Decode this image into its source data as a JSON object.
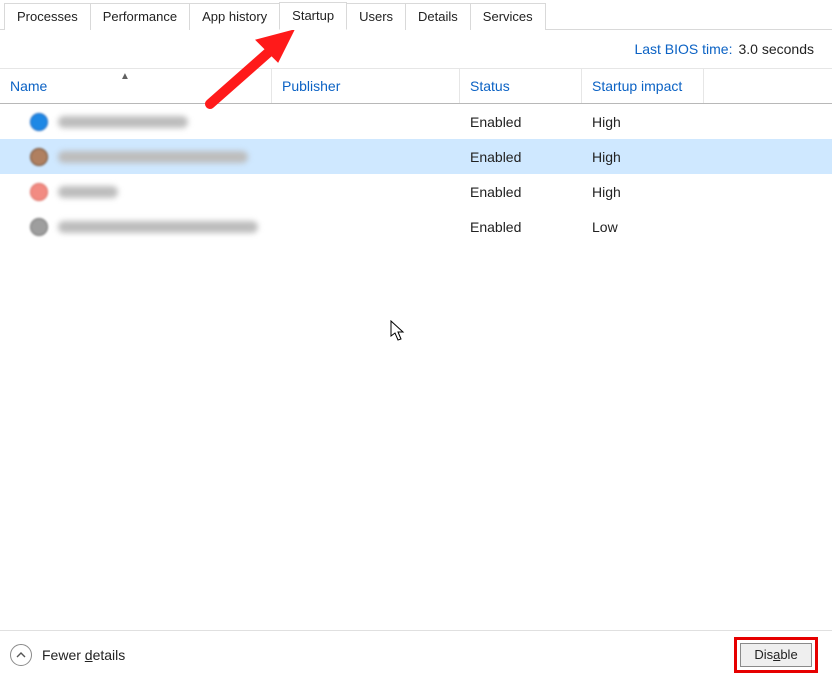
{
  "tabs": {
    "items": [
      {
        "label": "Processes",
        "active": false
      },
      {
        "label": "Performance",
        "active": false
      },
      {
        "label": "App history",
        "active": false
      },
      {
        "label": "Startup",
        "active": true
      },
      {
        "label": "Users",
        "active": false
      },
      {
        "label": "Details",
        "active": false
      },
      {
        "label": "Services",
        "active": false
      }
    ]
  },
  "info": {
    "label": "Last BIOS time:",
    "value": "3.0 seconds"
  },
  "columns": {
    "name": "Name",
    "publisher": "Publisher",
    "status": "Status",
    "impact": "Startup impact"
  },
  "rows": [
    {
      "icon_color": "#1e88e5",
      "name_blur_w": 130,
      "pub_blur_w": 150,
      "status": "Enabled",
      "impact": "High",
      "selected": false,
      "icon_border": "#1565c0"
    },
    {
      "icon_color": "#b08060",
      "name_blur_w": 190,
      "pub_blur_w": 150,
      "status": "Enabled",
      "impact": "High",
      "selected": true,
      "icon_border": "#6e4a30"
    },
    {
      "icon_color": "#f28b82",
      "name_blur_w": 60,
      "pub_blur_w": 150,
      "status": "Enabled",
      "impact": "High",
      "selected": false,
      "icon_border": "#d96a60"
    },
    {
      "icon_color": "#9e9e9e",
      "name_blur_w": 200,
      "pub_blur_w": 150,
      "status": "Enabled",
      "impact": "Low",
      "selected": false,
      "icon_border": "#707070"
    }
  ],
  "bottom": {
    "fewer_prefix": "Fewer ",
    "fewer_underline": "d",
    "fewer_suffix": "etails",
    "disable_prefix": "Dis",
    "disable_underline": "a",
    "disable_suffix": "ble"
  },
  "annotation": {
    "arrow_color": "#ff1a1a"
  }
}
